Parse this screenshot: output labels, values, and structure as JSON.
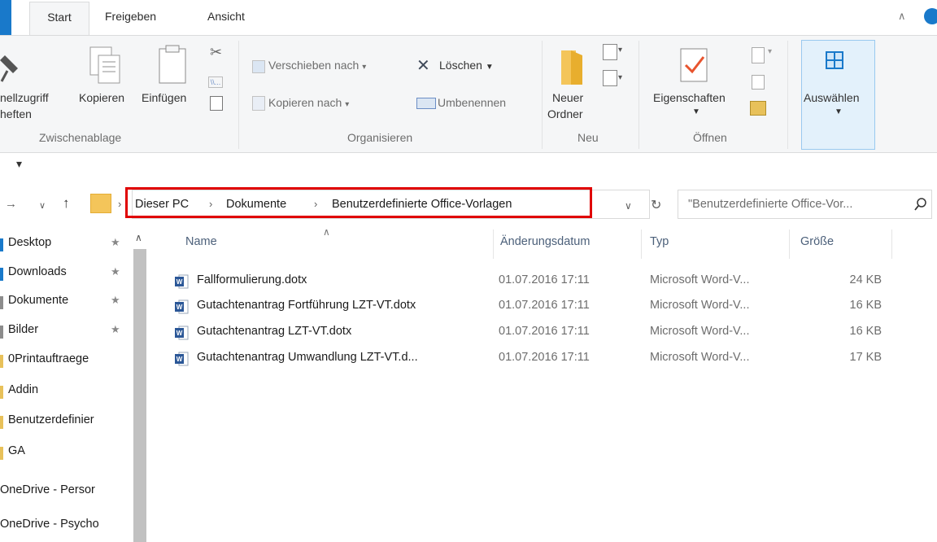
{
  "tabs": {
    "start": "Start",
    "share": "Freigeben",
    "view": "Ansicht"
  },
  "ribbon": {
    "clipboard": {
      "quickaccess": [
        "nellzugriff",
        "heften"
      ],
      "copy": "Kopieren",
      "paste": "Einfügen",
      "group_label": "Zwischenablage"
    },
    "organize": {
      "move_to": "Verschieben nach",
      "copy_to": "Kopieren nach",
      "delete": "Löschen",
      "rename": "Umbenennen",
      "group_label": "Organisieren"
    },
    "new": {
      "new_folder": [
        "Neuer",
        "Ordner"
      ],
      "group_label": "Neu"
    },
    "open": {
      "properties": "Eigenschaften",
      "group_label": "Öffnen"
    },
    "select": {
      "label": "Auswählen"
    }
  },
  "qat": {
    "arrow": "▾"
  },
  "address": {
    "crumbs": [
      "Dieser PC",
      "Dokumente",
      "Benutzerdefinierte Office-Vorlagen"
    ],
    "search_placeholder": "\"Benutzerdefinierte Office-Vor..."
  },
  "nav": {
    "items": [
      {
        "label": "Desktop",
        "pinned": true,
        "color": "#1979ca"
      },
      {
        "label": "Downloads",
        "pinned": true,
        "color": "#1979ca"
      },
      {
        "label": "Dokumente",
        "pinned": true,
        "color": "#8c8c8c"
      },
      {
        "label": "Bilder",
        "pinned": true,
        "color": "#8c8c8c"
      },
      {
        "label": "0Printauftraege",
        "pinned": false,
        "color": "#e8c15a"
      },
      {
        "label": "Addin",
        "pinned": false,
        "color": "#e8c15a"
      },
      {
        "label": "Benutzerdefinier",
        "pinned": false,
        "color": "#e8c15a"
      },
      {
        "label": "GA",
        "pinned": false,
        "color": "#e8c15a"
      },
      {
        "label": "OneDrive - Persor",
        "pinned": false,
        "color": "#ffffff"
      },
      {
        "label": "OneDrive - Psycho",
        "pinned": false,
        "color": "#ffffff"
      }
    ]
  },
  "columns": {
    "name": "Name",
    "date": "Änderungsdatum",
    "type": "Typ",
    "size": "Größe"
  },
  "files": [
    {
      "name": "Fallformulierung.dotx",
      "date": "01.07.2016 17:11",
      "type": "Microsoft Word-V...",
      "size": "24 KB"
    },
    {
      "name": "Gutachtenantrag Fortführung LZT-VT.dotx",
      "date": "01.07.2016 17:11",
      "type": "Microsoft Word-V...",
      "size": "16 KB"
    },
    {
      "name": "Gutachtenantrag LZT-VT.dotx",
      "date": "01.07.2016 17:11",
      "type": "Microsoft Word-V...",
      "size": "16 KB"
    },
    {
      "name": "Gutachtenantrag Umwandlung LZT-VT.d...",
      "date": "01.07.2016 17:11",
      "type": "Microsoft Word-V...",
      "size": "17 KB"
    }
  ]
}
